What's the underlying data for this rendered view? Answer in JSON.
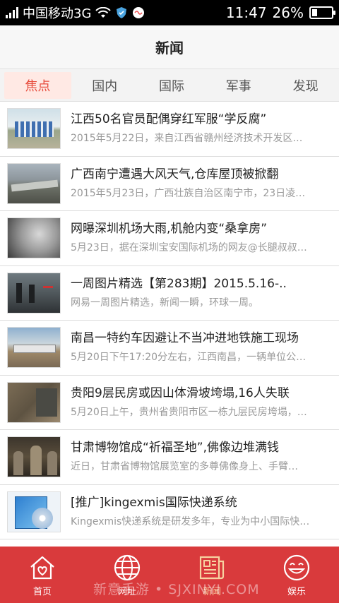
{
  "status_bar": {
    "carrier": "中国移动3G",
    "time": "11:47",
    "battery": "26%",
    "battery_level": 0.26
  },
  "header": {
    "title": "新闻"
  },
  "tabs": [
    {
      "label": "焦点",
      "active": true
    },
    {
      "label": "国内",
      "active": false
    },
    {
      "label": "国际",
      "active": false
    },
    {
      "label": "军事",
      "active": false
    },
    {
      "label": "发现",
      "active": false
    }
  ],
  "news": [
    {
      "title": "江西50名官员配偶穿红军服“学反腐”",
      "summary": "2015年5月22日，来自江西省赣州经济技术开发区…",
      "thumb": "people-outdoor"
    },
    {
      "title": "广西南宁遭遇大风天气,仓库屋顶被掀翻",
      "summary": "2015年5月23日，广西壮族自治区南宁市，23日凌…",
      "thumb": "damaged-roof"
    },
    {
      "title": "网曝深圳机场大雨,机舱内变“桑拿房”",
      "summary": "5月23日，据在深圳宝安国际机场的网友@长腿叔叔…",
      "thumb": "foggy-cabin"
    },
    {
      "title": "一周图片精选【第283期】2015.5.16-..",
      "summary": "网易一周图片精选，新闻一瞬，环球一周。",
      "thumb": "street-scene"
    },
    {
      "title": "南昌一特约车因避让不当冲进地铁施工现场",
      "summary": "5月20日下午17:20分左右，江西南昌，一辆单位公…",
      "thumb": "construction-site"
    },
    {
      "title": "贵阳9层民房或因山体滑坡垮塌,16人失联",
      "summary": "5月20日上午，贵州省贵阳市区一栋九层民房垮塌，…",
      "thumb": "collapse"
    },
    {
      "title": "甘肃博物馆成“祈福圣地”,佛像边堆满钱",
      "summary": "近日，甘肃省博物馆展览室的多尊佛像身上、手臂…",
      "thumb": "statues"
    },
    {
      "title": "[推广]kingexmis国际快递系统",
      "summary": "Kingexmis快递系统是研发多年，专业为中小国际快…",
      "thumb": "software-box"
    }
  ],
  "bottom_nav": [
    {
      "label": "首页",
      "icon": "home-heart-icon",
      "active": false
    },
    {
      "label": "网址",
      "icon": "globe-icon",
      "active": false
    },
    {
      "label": "新闻",
      "icon": "newspaper-icon",
      "active": true
    },
    {
      "label": "娱乐",
      "icon": "smiley-icon",
      "active": false
    }
  ],
  "watermark": "新意手游 • SJXINYI.COM",
  "colors": {
    "accent": "#d93a3c",
    "active_tab_bg": "#ffe9e4",
    "active_tab_text": "#e74c3c",
    "active_nav": "#f7d2a1"
  }
}
